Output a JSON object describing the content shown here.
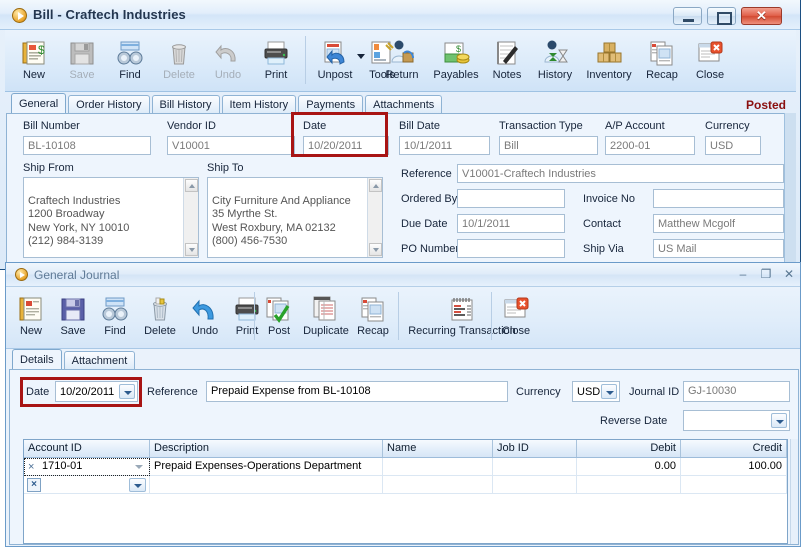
{
  "bill_window": {
    "title": "Bill - Craftech Industries",
    "app_icon": "play-circle-icon",
    "window_controls": {
      "minimize": "minimize-icon",
      "maximize": "maximize-icon",
      "close": "close-icon"
    },
    "toolbar": [
      {
        "label": "New",
        "icon": "new-document-icon",
        "disabled": false
      },
      {
        "label": "Save",
        "icon": "floppy-disk-icon",
        "disabled": true
      },
      {
        "label": "Find",
        "icon": "binoculars-icon",
        "disabled": false
      },
      {
        "label": "Delete",
        "icon": "trash-can-icon",
        "disabled": true
      },
      {
        "label": "Undo",
        "icon": "undo-arrow-icon",
        "disabled": true
      },
      {
        "label": "Print",
        "icon": "printer-icon",
        "disabled": false
      },
      {
        "label": "Unpost",
        "icon": "unpost-icon",
        "disabled": false
      },
      {
        "label": "Tools",
        "icon": "tools-icon",
        "disabled": false
      },
      {
        "label": "Return",
        "icon": "return-package-icon",
        "disabled": false
      },
      {
        "label": "Payables",
        "icon": "payables-money-icon",
        "disabled": false
      },
      {
        "label": "Notes",
        "icon": "notepad-pen-icon",
        "disabled": false
      },
      {
        "label": "History",
        "icon": "history-hourglass-icon",
        "disabled": false
      },
      {
        "label": "Inventory",
        "icon": "inventory-boxes-icon",
        "disabled": false
      },
      {
        "label": "Recap",
        "icon": "recap-pages-icon",
        "disabled": false
      },
      {
        "label": "Close",
        "icon": "close-window-icon",
        "disabled": false
      }
    ],
    "tools_dropdown_icon": "chevron-down-icon",
    "tabs": [
      {
        "label": "General",
        "active": true
      },
      {
        "label": "Order History",
        "active": false
      },
      {
        "label": "Bill History",
        "active": false
      },
      {
        "label": "Item History",
        "active": false
      },
      {
        "label": "Payments",
        "active": false
      },
      {
        "label": "Attachments",
        "active": false
      }
    ],
    "status": "Posted",
    "fields": {
      "bill_number_label": "Bill Number",
      "bill_number_value": "BL-10108",
      "vendor_id_label": "Vendor ID",
      "vendor_id_value": "V10001",
      "date_label": "Date",
      "date_value": "10/20/2011",
      "bill_date_label": "Bill Date",
      "bill_date_value": "10/1/2011",
      "transaction_type_label": "Transaction Type",
      "transaction_type_value": "Bill",
      "ap_account_label": "A/P Account",
      "ap_account_value": "2200-01",
      "currency_label": "Currency",
      "currency_value": "USD",
      "ship_from_label": "Ship From",
      "ship_from_value": "Craftech Industries\n1200 Broadway\nNew York, NY 10010\n(212) 984-3139",
      "ship_to_label": "Ship To",
      "ship_to_value": "City Furniture And Appliance\n35 Myrthe St.\nWest Roxbury, MA 02132\n(800) 456-7530",
      "reference_label": "Reference",
      "reference_value": "V10001-Craftech Industries",
      "ordered_by_label": "Ordered By",
      "ordered_by_value": "",
      "invoice_no_label": "Invoice No",
      "invoice_no_value": "",
      "due_date_label": "Due Date",
      "due_date_value": "10/1/2011",
      "contact_label": "Contact",
      "contact_value": "Matthew Mcgolf",
      "po_number_label": "PO Number",
      "po_number_value": "",
      "ship_via_label": "Ship Via",
      "ship_via_value": "US Mail"
    }
  },
  "journal_window": {
    "title": "General Journal",
    "app_icon": "play-circle-icon",
    "window_controls": {
      "minimize": "minimize-icon",
      "maximize": "maximize-icon",
      "close": "close-icon"
    },
    "toolbar": [
      {
        "label": "New",
        "icon": "new-document-icon"
      },
      {
        "label": "Save",
        "icon": "floppy-disk-icon"
      },
      {
        "label": "Find",
        "icon": "binoculars-icon"
      },
      {
        "label": "Delete",
        "icon": "trash-can-icon"
      },
      {
        "label": "Undo",
        "icon": "undo-arrow-icon"
      },
      {
        "label": "Print",
        "icon": "printer-icon"
      },
      {
        "label": "Post",
        "icon": "post-checkmark-icon"
      },
      {
        "label": "Duplicate",
        "icon": "duplicate-pages-icon"
      },
      {
        "label": "Recap",
        "icon": "recap-pages-icon"
      },
      {
        "label": "Recurring Transaction",
        "icon": "calendar-recurring-icon"
      },
      {
        "label": "Close",
        "icon": "close-window-icon"
      }
    ],
    "tabs": [
      {
        "label": "Details",
        "active": true
      },
      {
        "label": "Attachment",
        "active": false
      }
    ],
    "fields": {
      "date_label": "Date",
      "date_value": "10/20/2011",
      "reference_label": "Reference",
      "reference_value": "Prepaid Expense from BL-10108",
      "currency_label": "Currency",
      "currency_value": "USD",
      "journal_id_label": "Journal ID",
      "journal_id_value": "GJ-10030",
      "reverse_date_label": "Reverse Date",
      "reverse_date_value": ""
    },
    "grid": {
      "columns": [
        "Account ID",
        "Description",
        "Name",
        "Job ID",
        "Debit",
        "Credit"
      ],
      "rows": [
        {
          "row_marker": "×",
          "account_id": "1710-01",
          "description": "Prepaid Expenses-Operations Department",
          "name": "",
          "job_id": "",
          "debit": "0.00",
          "credit": "100.00"
        },
        {
          "row_marker": "×",
          "account_id": "",
          "description": "",
          "name": "",
          "job_id": "",
          "debit": "",
          "credit": ""
        }
      ]
    }
  },
  "highlights": {
    "bill_date_box_color": "#a81414",
    "journal_date_box_color": "#a81414"
  }
}
